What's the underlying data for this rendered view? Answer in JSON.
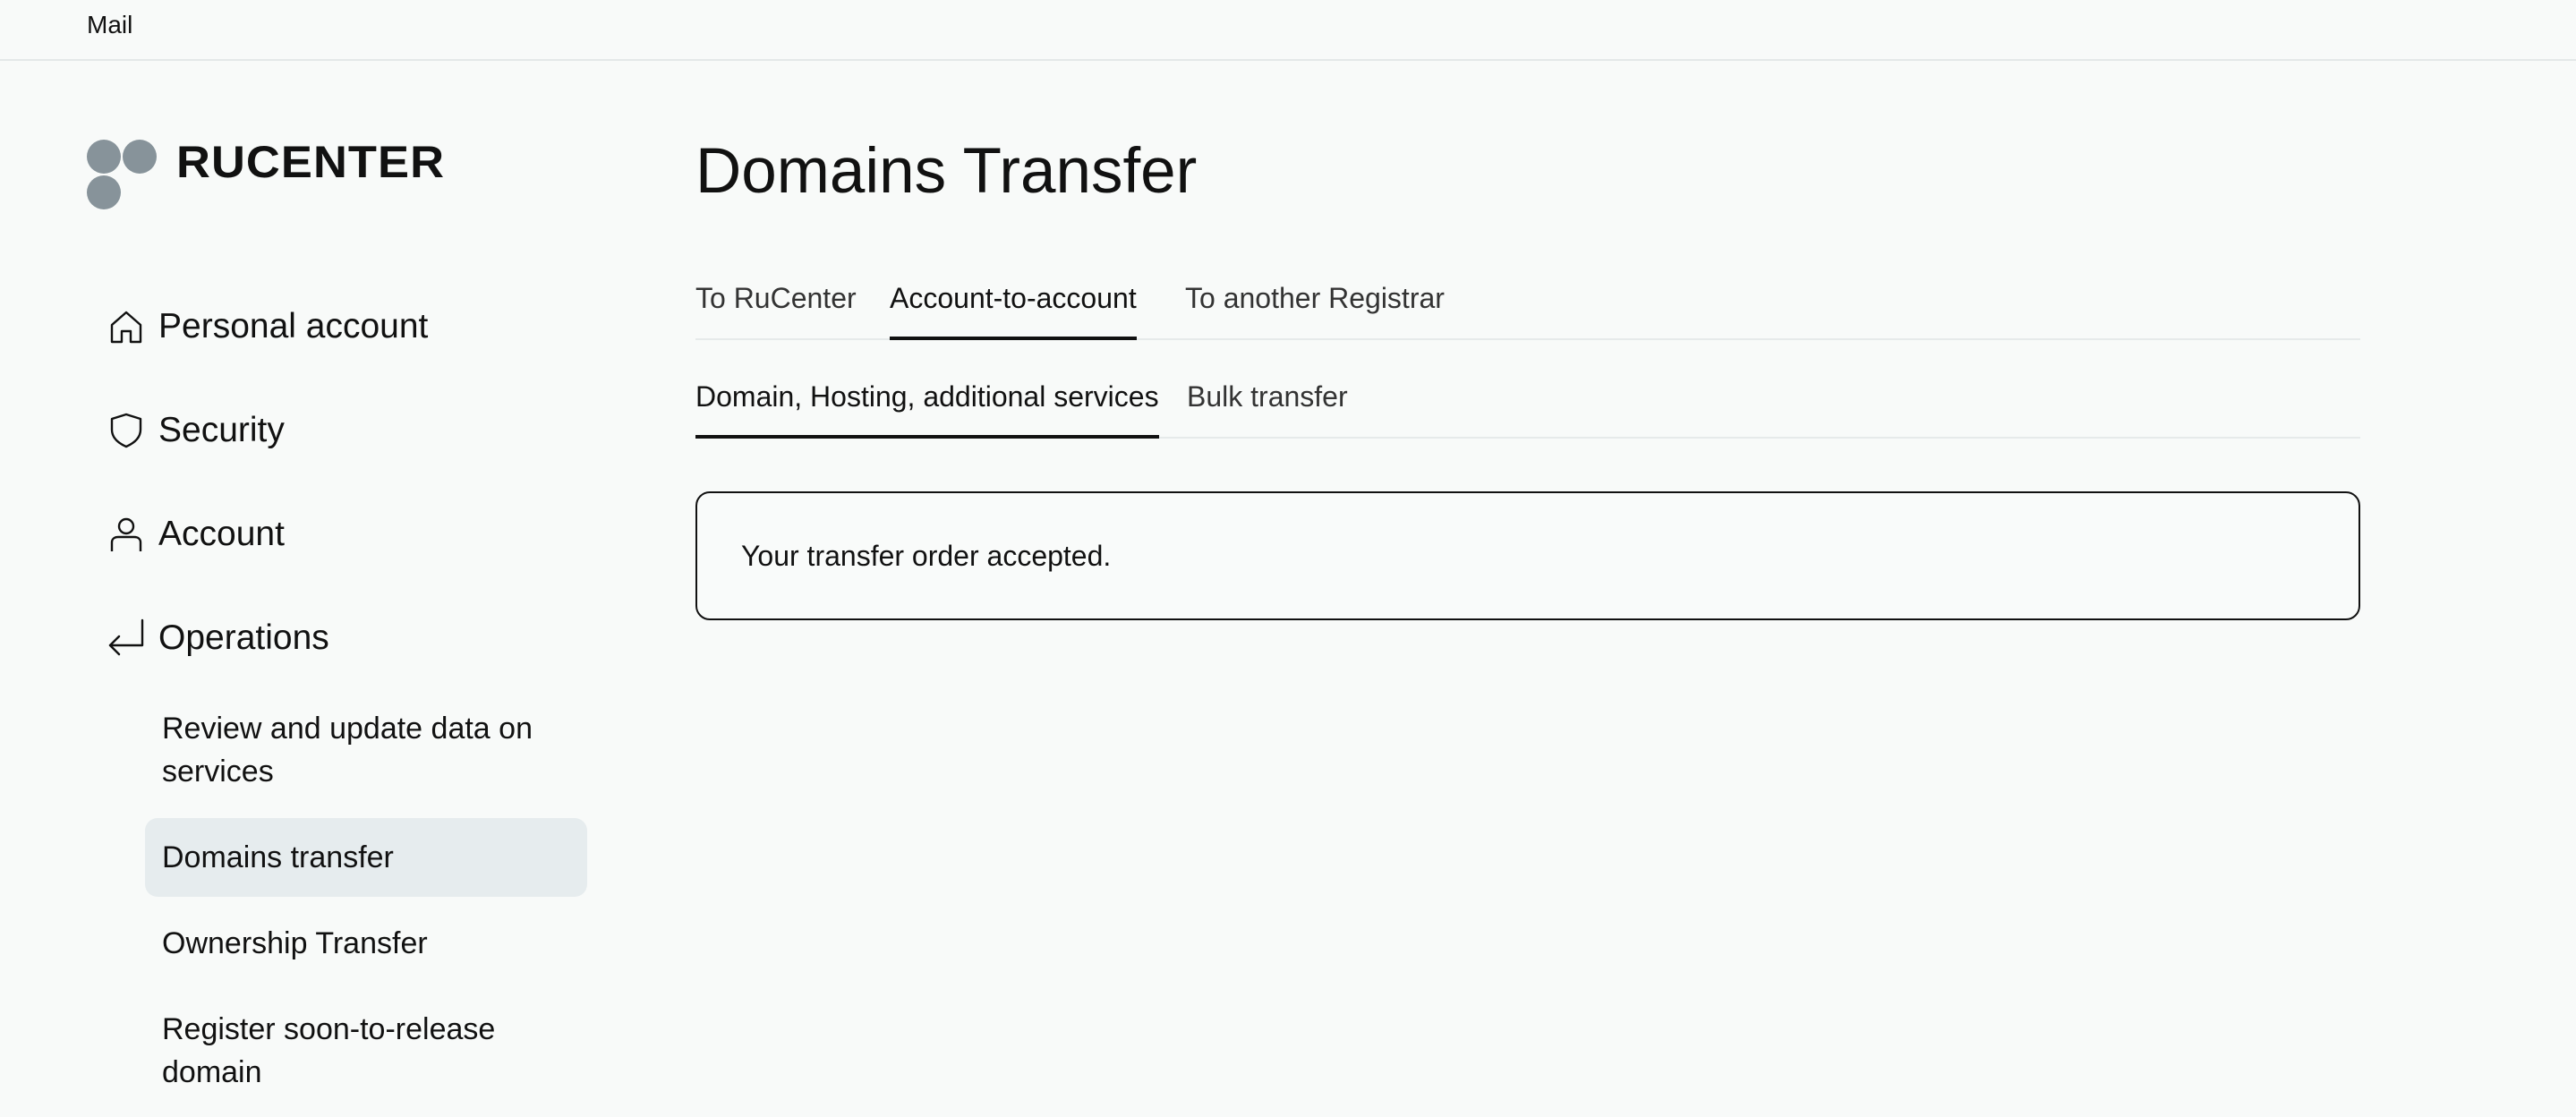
{
  "topbar": {
    "mail_label": "Mail"
  },
  "logo": {
    "text": "RUCENTER"
  },
  "sidebar": {
    "items": [
      {
        "label": "Personal account",
        "icon": "home-icon"
      },
      {
        "label": "Security",
        "icon": "shield-icon"
      },
      {
        "label": "Account",
        "icon": "user-icon"
      },
      {
        "label": "Operations",
        "icon": "return-arrow-icon"
      }
    ],
    "sub_items": [
      {
        "label": "Review and update data on services"
      },
      {
        "label": "Domains transfer",
        "active": true
      },
      {
        "label": "Ownership Transfer"
      },
      {
        "label": "Register soon-to-release domain"
      }
    ]
  },
  "main": {
    "title": "Domains Transfer",
    "tabs": [
      {
        "label": "To RuCenter",
        "active": false
      },
      {
        "label": "Account-to-account",
        "active": true
      },
      {
        "label": "To another Registrar",
        "active": false
      }
    ],
    "subtabs": [
      {
        "label": "Domain, Hosting, additional services",
        "active": true
      },
      {
        "label": "Bulk transfer",
        "active": false
      }
    ],
    "notice": "Your transfer order accepted."
  },
  "colors": {
    "background": "#f8faf9",
    "logo_dots": "#87939a",
    "active_sub_item_bg": "#e6ecee",
    "text": "#111111"
  }
}
